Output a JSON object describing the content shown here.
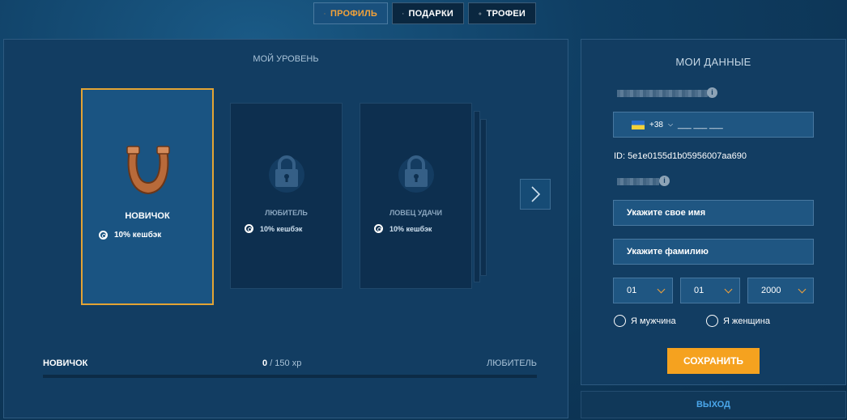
{
  "tabs": [
    {
      "label": "ПРОФИЛЬ",
      "icon": "user-icon",
      "active": true
    },
    {
      "label": "ПОДАРКИ",
      "icon": "gift-icon",
      "active": false
    },
    {
      "label": "ТРОФЕИ",
      "icon": "trophy-icon",
      "active": false
    }
  ],
  "level": {
    "title": "МОЙ УРОВЕНЬ",
    "cards": [
      {
        "name": "НОВИЧОК",
        "cashback": "10% кешбэк",
        "icon": "horseshoe-icon",
        "locked": false
      },
      {
        "name": "ЛЮБИТЕЛЬ",
        "cashback": "10% кешбэк",
        "icon": "lock-icon",
        "locked": true
      },
      {
        "name": "ЛОВЕЦ УДАЧИ",
        "cashback": "10% кешбэк",
        "icon": "lock-icon",
        "locked": true
      }
    ],
    "progress": {
      "current_level": "НОВИЧОК",
      "xp_current": "0",
      "xp_total": "/ 150 xp",
      "next_level": "ЛЮБИТЕЛЬ",
      "fraction": 0
    }
  },
  "my_data": {
    "title": "МОИ ДАННЫЕ",
    "phone": {
      "code": "+38",
      "mask": "___ ___ ___"
    },
    "user_id": "ID: 5e1e0155d1b05956007aa690",
    "first_name_placeholder": "Укажите свое имя",
    "last_name_placeholder": "Укажите фамилию",
    "birth": {
      "day": "01",
      "month": "01",
      "year": "2000"
    },
    "gender_male": "Я мужчина",
    "gender_female": "Я женщина",
    "save_label": "СОХРАНИТЬ",
    "logout_label": "ВЫХОД"
  },
  "colors": {
    "accent": "#f5a21f",
    "link": "#4aa6ea",
    "panel": "#123d62"
  }
}
